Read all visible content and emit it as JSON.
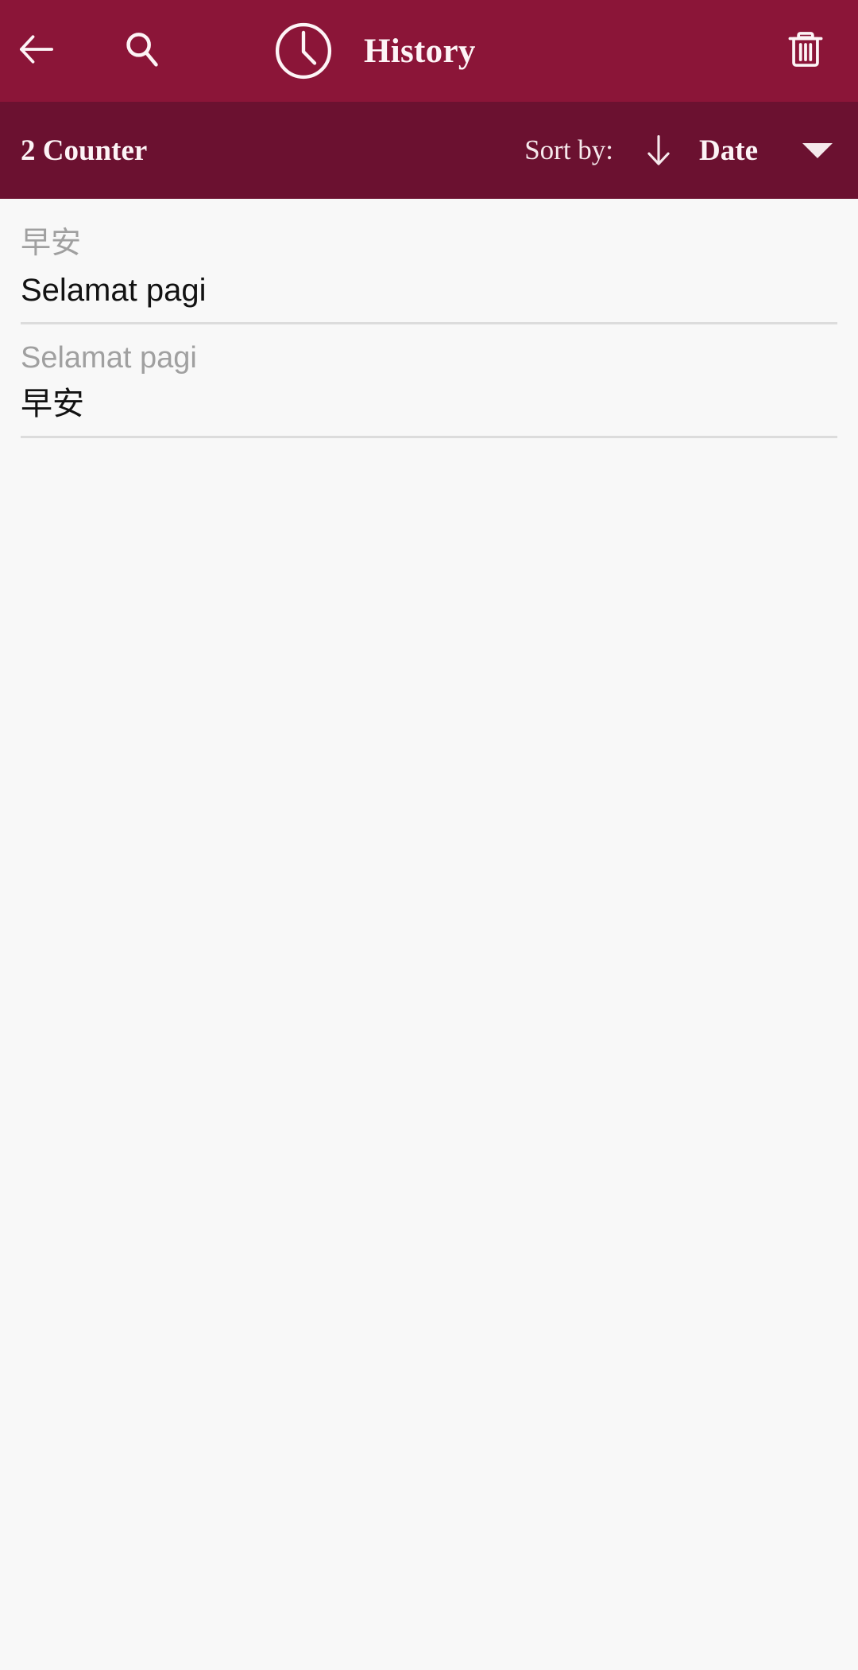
{
  "appbar": {
    "background": "#8b1538",
    "title": "History",
    "back_icon": "back-arrow-icon",
    "search_icon": "search-icon",
    "clock_icon": "clock-icon",
    "delete_icon": "trash-icon"
  },
  "sortbar": {
    "background": "#6b1130",
    "counter_label": "2 Counter",
    "sort_by_label": "Sort by:",
    "sort_direction_icon": "arrow-down-icon",
    "sort_value": "Date",
    "dropdown_icon": "caret-down-icon"
  },
  "history": {
    "items": [
      {
        "source": "早安",
        "target": "Selamat pagi"
      },
      {
        "source": "Selamat pagi",
        "target": "早安"
      }
    ]
  },
  "colors": {
    "appbar": "#8b1538",
    "sortbar": "#6b1130",
    "page_background": "#f8f8f8",
    "source_text": "#a0a0a0",
    "target_text": "#121212",
    "divider": "#dcdcdc",
    "on_primary_text": "#fdf4f6"
  }
}
